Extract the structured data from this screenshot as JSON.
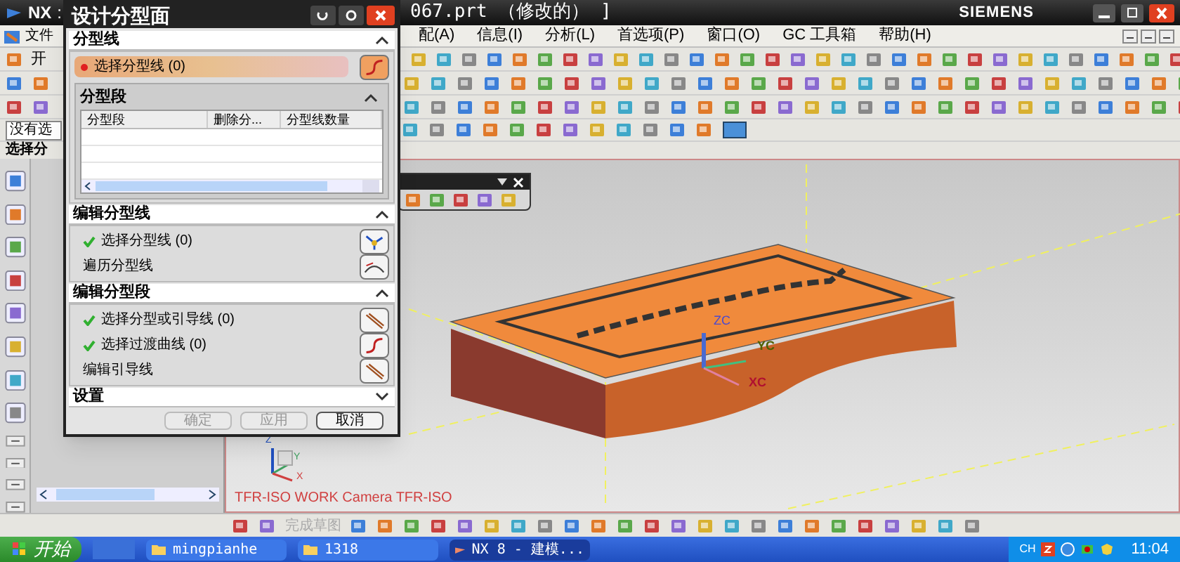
{
  "title_bar": {
    "app": "NX",
    "separator": ":",
    "file": "067.prt （修改的） ]",
    "brand": "SIEMENS"
  },
  "menu_bar": [
    {
      "label": "文件"
    },
    {
      "label": "配(A)"
    },
    {
      "label": "信息(I)"
    },
    {
      "label": "分析(L)"
    },
    {
      "label": "首选项(P)"
    },
    {
      "label": "窗口(O)"
    },
    {
      "label": "GC 工具箱"
    },
    {
      "label": "帮助(H)"
    }
  ],
  "toolbar": {
    "start_label": "开",
    "selection_filter": "没有选",
    "resource_label": "选择分"
  },
  "dialog": {
    "title": "设计分型面",
    "sections": [
      {
        "title": "分型线",
        "expanded": true,
        "kind": "parting",
        "rows": [
          {
            "label": "选择分型线 (0)",
            "required": true
          }
        ],
        "group": {
          "title": "分型段",
          "expanded": true,
          "columns": [
            "分型段",
            "删除分...",
            "分型线数量"
          ]
        }
      },
      {
        "title": "编辑分型线",
        "expanded": true,
        "kind": "rows",
        "rows": [
          {
            "label": "选择分型线 (0)",
            "checked": true
          },
          {
            "label": "遍历分型线",
            "checked": false
          }
        ]
      },
      {
        "title": "编辑分型段",
        "expanded": true,
        "kind": "rows",
        "rows": [
          {
            "label": "选择分型或引导线 (0)",
            "checked": true
          },
          {
            "label": "选择过渡曲线 (0)",
            "checked": true
          },
          {
            "label": "编辑引导线",
            "checked": false
          }
        ]
      },
      {
        "title": "设置",
        "expanded": false,
        "kind": "rows"
      }
    ],
    "buttons": [
      {
        "label": "确定",
        "disabled": true
      },
      {
        "label": "应用",
        "disabled": true
      },
      {
        "label": "取消",
        "disabled": false
      }
    ]
  },
  "viewport": {
    "view_label": "TFR-ISO WORK Camera TFR-ISO",
    "axes": [
      "ZC",
      "YC",
      "XC"
    ],
    "mini_axes": [
      "Z",
      "Y",
      "X"
    ]
  },
  "sketch_toolbar": {
    "finish_label": "完成草图",
    "disabled": true
  },
  "taskbar": {
    "start": "开始",
    "tasks": [
      {
        "label": "mingpianhe",
        "selected": false
      },
      {
        "label": "1318",
        "selected": false
      },
      {
        "label": "NX 8 - 建模...",
        "selected": true
      }
    ],
    "language": "CH",
    "clock": "11:04"
  }
}
